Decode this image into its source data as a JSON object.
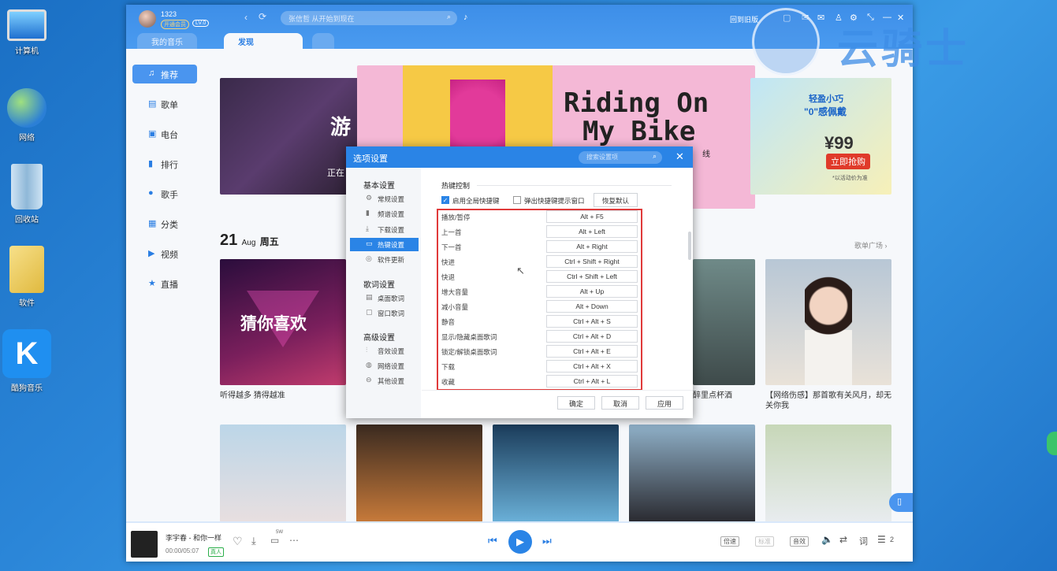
{
  "desktop": {
    "icons": [
      {
        "label": "计算机"
      },
      {
        "label": "网络"
      },
      {
        "label": "回收站"
      },
      {
        "label": "软件"
      },
      {
        "label": "酷狗音乐"
      }
    ]
  },
  "watermark": {
    "text": "云骑士"
  },
  "app": {
    "user": {
      "name": "1323",
      "vip_badge": "开通会员",
      "level": "LV.0"
    },
    "search_placeholder": "张信哲 从开始到现在",
    "toolbar": {
      "old_version": "回到旧版"
    },
    "tabs": [
      {
        "label": "我的音乐"
      },
      {
        "label": "发现"
      }
    ],
    "sidebar": [
      {
        "label": "推荐",
        "icon": "recommend-icon"
      },
      {
        "label": "歌单",
        "icon": "playlist-icon"
      },
      {
        "label": "电台",
        "icon": "radio-icon"
      },
      {
        "label": "排行",
        "icon": "chart-icon"
      },
      {
        "label": "歌手",
        "icon": "singer-icon"
      },
      {
        "label": "分类",
        "icon": "category-icon"
      },
      {
        "label": "视频",
        "icon": "video-icon"
      },
      {
        "label": "直播",
        "icon": "live-icon"
      }
    ],
    "banners": {
      "left_text": "游",
      "left_subtext": "正在",
      "center_title_line1": "Riding On",
      "center_title_line2": "My Bike",
      "center_side_text": "线",
      "right_title": "轻盈小巧",
      "right_subtitle": "\"0\"感佩戴",
      "right_price": "¥99",
      "right_button": "立即抢购",
      "right_note": "*以活动价为准"
    },
    "date": {
      "day": "21",
      "month": "Aug",
      "weekday": "周五"
    },
    "playlist_square_link": "歌单广场 ›",
    "cards_row1": [
      {
        "title": "猜你喜欢",
        "caption": "听得越多 猜得越准"
      },
      {
        "caption": "醉里点杯酒"
      },
      {
        "caption": "【网络伤感】那首歌有关风月，却无关你我"
      }
    ],
    "player": {
      "song": "李宇春 - 和你一样",
      "time": "00:00/05:07",
      "tag": "真人",
      "comment_count": "5W",
      "speed": "倍速",
      "quality_std": "标准",
      "sound_effect": "音效",
      "lyrics": "词",
      "queue_count": "2"
    }
  },
  "dialog": {
    "title": "选项设置",
    "search_placeholder": "搜索设置项",
    "nav": {
      "basic": {
        "title": "基本设置",
        "items": [
          "常规设置",
          "频谱设置",
          "下载设置",
          "热键设置",
          "软件更新"
        ]
      },
      "lyrics": {
        "title": "歌词设置",
        "items": [
          "桌面歌词",
          "窗口歌词"
        ]
      },
      "advanced": {
        "title": "高级设置",
        "items": [
          "音效设置",
          "网络设置",
          "其他设置"
        ]
      }
    },
    "section_title": "热键控制",
    "enable_global": "启用全局快捷键",
    "popup_hint": "弹出快捷键提示窗口",
    "restore_default": "恢复默认",
    "hotkeys": [
      {
        "action": "播放/暂停",
        "key": "Alt + F5"
      },
      {
        "action": "上一首",
        "key": "Alt + Left"
      },
      {
        "action": "下一首",
        "key": "Alt + Right"
      },
      {
        "action": "快进",
        "key": "Ctrl + Shift + Right"
      },
      {
        "action": "快退",
        "key": "Ctrl + Shift + Left"
      },
      {
        "action": "增大音量",
        "key": "Alt + Up"
      },
      {
        "action": "减小音量",
        "key": "Alt + Down"
      },
      {
        "action": "静音",
        "key": "Ctrl + Alt + S"
      },
      {
        "action": "显示/隐藏桌面歌词",
        "key": "Ctrl + Alt + D"
      },
      {
        "action": "锁定/解锁桌面歌词",
        "key": "Ctrl + Alt + E"
      },
      {
        "action": "下载",
        "key": "Ctrl + Alt + X"
      },
      {
        "action": "收藏",
        "key": "Ctrl + Alt + L"
      }
    ],
    "buttons": {
      "ok": "确定",
      "cancel": "取消",
      "apply": "应用"
    },
    "highlight_color": "#e03a3a"
  }
}
